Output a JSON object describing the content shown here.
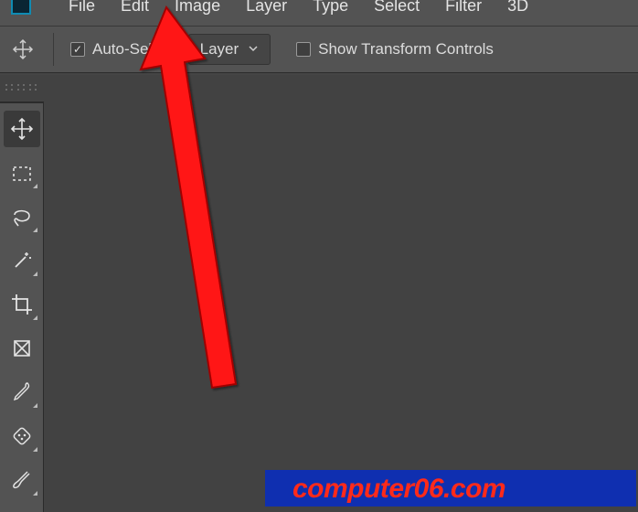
{
  "menubar": {
    "items": [
      "File",
      "Edit",
      "Image",
      "Layer",
      "Type",
      "Select",
      "Filter",
      "3D"
    ]
  },
  "optionbar": {
    "auto_select_label": "Auto-Select:",
    "layer_dropdown": "Layer",
    "show_transform_label": "Show Transform Controls"
  },
  "tools": [
    {
      "name": "move-tool"
    },
    {
      "name": "marquee-tool"
    },
    {
      "name": "lasso-tool"
    },
    {
      "name": "magic-wand-tool"
    },
    {
      "name": "crop-tool"
    },
    {
      "name": "frame-tool"
    },
    {
      "name": "eyedropper-tool"
    },
    {
      "name": "healing-brush-tool"
    },
    {
      "name": "brush-tool"
    }
  ],
  "watermark": "computer06.com"
}
